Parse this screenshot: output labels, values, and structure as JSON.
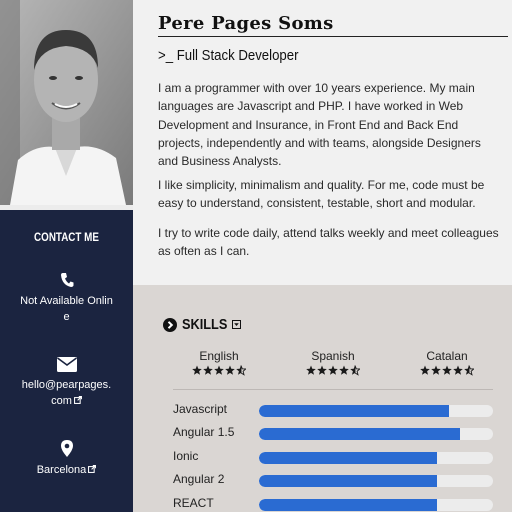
{
  "profile": {
    "name": "Pere Pages Soms",
    "job_title": ">_ Full Stack Developer",
    "paragraphs": [
      "I am a programmer with over 10 years experience. My main languages are Javascript and PHP. I have worked in Web Development and Insurance, in Front End and Back End projects, independently and with teams, alongside Designers and Business Analysts.",
      "I like simplicity, minimalism and quality. For me, code must be easy to understand, consistent, testable, short and modular.",
      "I try to write code daily, attend talks weekly and meet colleagues as often as I can."
    ]
  },
  "sidebar": {
    "contact_title": "CONTACT ME",
    "items": [
      {
        "icon": "phone-icon",
        "text": "Not Available Online"
      },
      {
        "icon": "envelope-icon",
        "text": "hello@pearpages.com",
        "external": true
      },
      {
        "icon": "map-marker-icon",
        "text": "Barcelona",
        "external": true
      }
    ]
  },
  "skills": {
    "title": "SKILLS",
    "languages": [
      {
        "name": "English",
        "rating": 4.5
      },
      {
        "name": "Spanish",
        "rating": 4.5
      },
      {
        "name": "Catalan",
        "rating": 4.5
      }
    ],
    "items": [
      {
        "name": "Javascript",
        "level": 0.81
      },
      {
        "name": "Angular 1.5",
        "level": 0.86
      },
      {
        "name": "Ionic",
        "level": 0.76
      },
      {
        "name": "Angular 2",
        "level": 0.76
      },
      {
        "name": "REACT",
        "level": 0.76
      }
    ]
  },
  "colors": {
    "sidebar_bg": "#1b2440",
    "bar_fill": "#2a6bd2",
    "bar_track": "#ececec",
    "skills_bg": "#dad6d3"
  }
}
